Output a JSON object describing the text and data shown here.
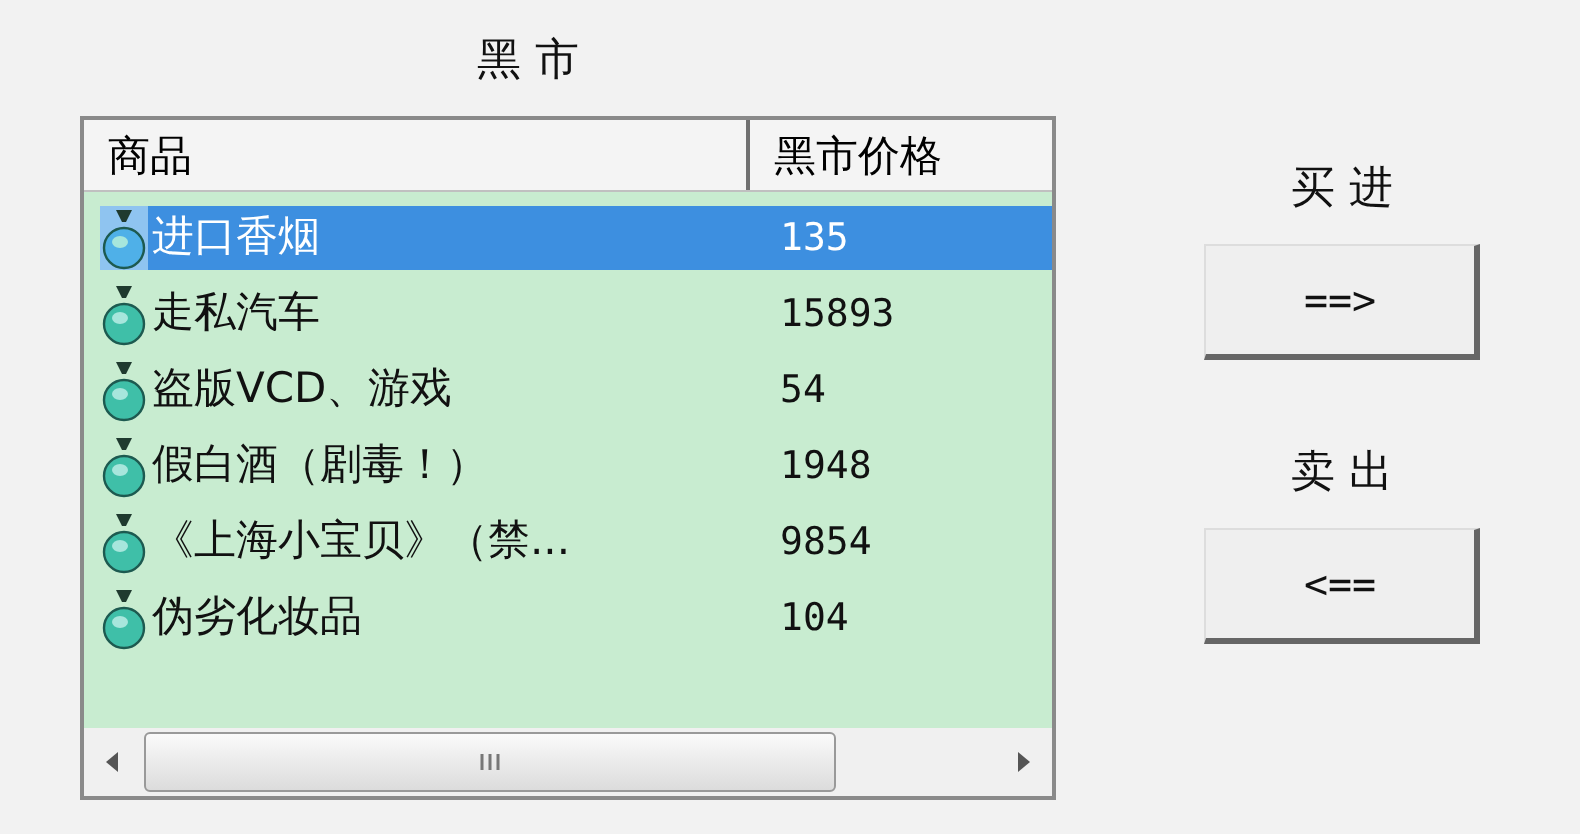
{
  "title": "黑 市",
  "table": {
    "columns": [
      "商品",
      "黑市价格"
    ],
    "rows": [
      {
        "name": "进口香烟",
        "price": "135",
        "selected": true
      },
      {
        "name": "走私汽车",
        "price": "15893",
        "selected": false
      },
      {
        "name": "盗版VCD、游戏",
        "price": "54",
        "selected": false
      },
      {
        "name": "假白酒（剧毒！）",
        "price": "1948",
        "selected": false
      },
      {
        "name": "《上海小宝贝》（禁...",
        "price": "9854",
        "selected": false
      },
      {
        "name": "伪劣化妆品",
        "price": "104",
        "selected": false
      }
    ]
  },
  "actions": [
    {
      "label": "买 进",
      "button": "==>"
    },
    {
      "label": "卖 出",
      "button": "<=="
    }
  ]
}
